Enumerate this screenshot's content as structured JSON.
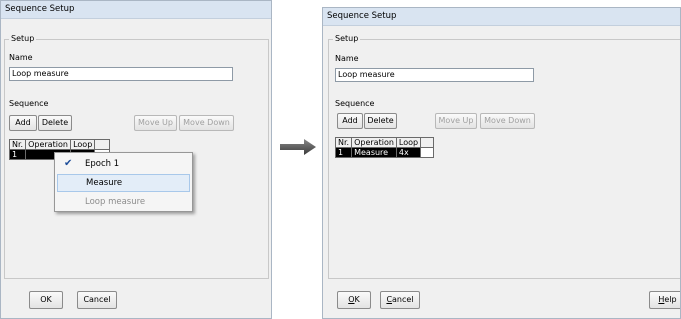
{
  "left": {
    "title": "Sequence Setup",
    "setup_legend": "Setup",
    "name_label": "Name",
    "name_value": "Loop measure",
    "sequence_label": "Sequence",
    "buttons": {
      "add": "Add",
      "delete": "Delete",
      "move_up": "Move Up",
      "move_down": "Move Down"
    },
    "table": {
      "headers": [
        "Nr.",
        "Operation",
        "Loop"
      ],
      "rows": [
        [
          "1",
          "",
          ""
        ]
      ]
    },
    "menu": {
      "items": [
        "Epoch 1",
        "Measure",
        "Loop measure"
      ],
      "checked": "Epoch 1",
      "highlighted": "Measure",
      "disabled": "Loop measure"
    },
    "footer": {
      "ok": "OK",
      "cancel": "Cancel"
    }
  },
  "right": {
    "title": "Sequence Setup",
    "setup_legend": "Setup",
    "name_label": "Name",
    "name_value": "Loop measure",
    "sequence_label": "Sequence",
    "buttons": {
      "add": "Add",
      "delete": "Delete",
      "move_up": "Move Up",
      "move_down": "Move Down"
    },
    "table": {
      "headers": [
        "Nr.",
        "Operation",
        "Loop"
      ],
      "rows": [
        [
          "1",
          "Measure",
          "4x"
        ]
      ]
    },
    "footer": {
      "ok_mnemonic": "O",
      "ok_rest": "K",
      "cancel_mnemonic": "C",
      "cancel_rest": "ancel",
      "help_mnemonic": "H",
      "help_rest": "elp"
    }
  },
  "colors": {
    "titlebar": "#d9e4f1",
    "dialog_bg": "#f0f0f0",
    "menu_highlight": "#e3edf8",
    "arrow": "#555555"
  },
  "icons": {
    "checkmark": "check-icon",
    "arrow": "right-arrow-icon"
  }
}
